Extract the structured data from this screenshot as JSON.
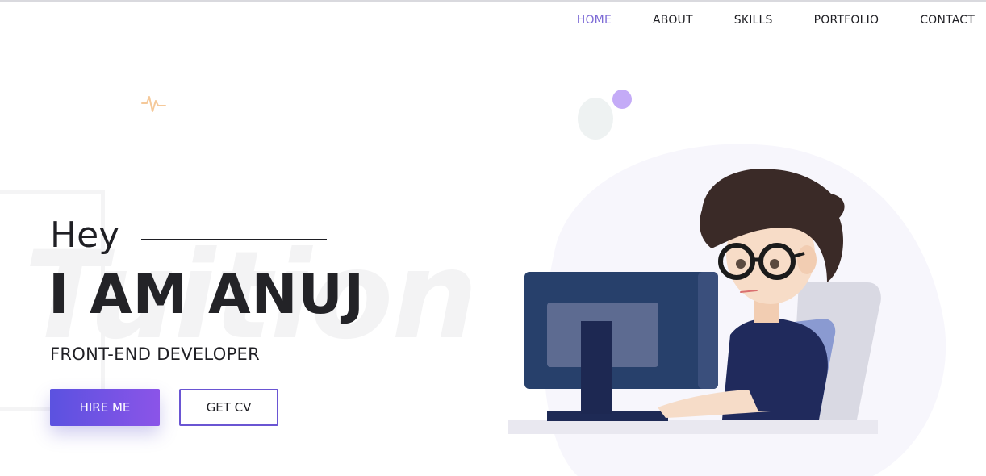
{
  "nav": {
    "items": [
      {
        "label": "HOME",
        "active": true
      },
      {
        "label": "ABOUT",
        "active": false
      },
      {
        "label": "SKILLS",
        "active": false
      },
      {
        "label": "PORTFOLIO",
        "active": false
      },
      {
        "label": "CONTACT",
        "active": false
      }
    ],
    "active_color": "#7d6bd6"
  },
  "hero": {
    "greeting": "Hey",
    "name": "I AM ANUJ",
    "role": "FRONT-END DEVELOPER",
    "watermark": "Tuition",
    "hire_label": "HIRE ME",
    "cv_label": "GET CV"
  },
  "colors": {
    "button_gradient_start": "#5b52e0",
    "button_gradient_end": "#8b54e8",
    "outline_button_border": "#6a55d3",
    "accent_dot": "#c4abf7"
  },
  "illustration": "developer-at-computer"
}
